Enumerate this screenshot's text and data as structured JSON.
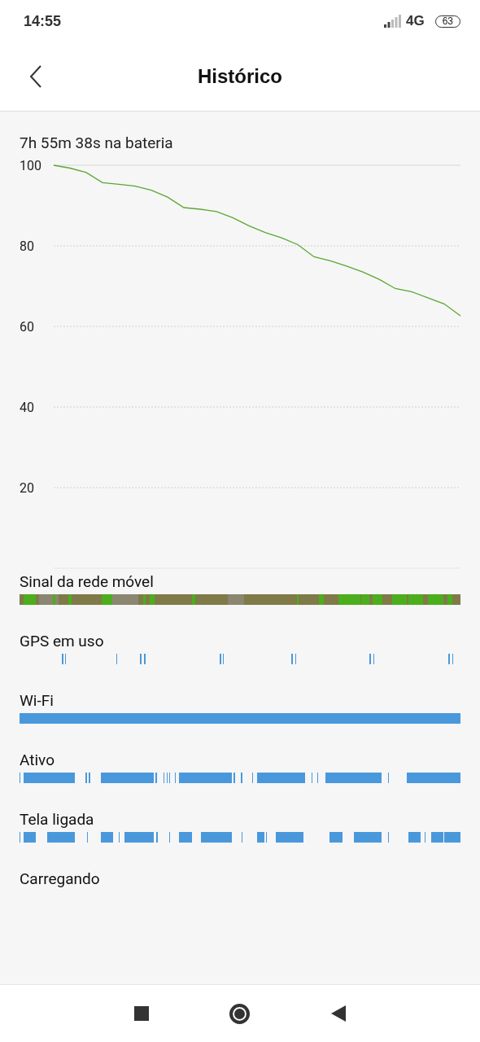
{
  "status_bar": {
    "time": "14:55",
    "network": "4G",
    "battery": "63"
  },
  "header": {
    "title": "Histórico"
  },
  "summary": "7h 55m 38s na bateria",
  "chart_data": {
    "type": "line",
    "ylim": [
      0,
      100
    ],
    "yticks": [
      20,
      40,
      60,
      80,
      100
    ],
    "grid": true,
    "categories": [
      null,
      null,
      null,
      null,
      null,
      null,
      null,
      null,
      null,
      null,
      null,
      null,
      null,
      null,
      null,
      null,
      null,
      null,
      null,
      null,
      null,
      null,
      null,
      null,
      null,
      null
    ],
    "series": [
      {
        "color": "#5aa832",
        "values": [
          100,
          99.3,
          98.2,
          95.7,
          95.3,
          94.8,
          93.8,
          92.1,
          89.5,
          89.1,
          88.5,
          87,
          85,
          83.3,
          82,
          80.3,
          77.3,
          76.3,
          75,
          73.5,
          71.7,
          69.4,
          68.6,
          67.1,
          65.6,
          62.6
        ]
      }
    ]
  },
  "timelines": [
    {
      "label": "Sinal da rede móvel",
      "kind": "signal"
    },
    {
      "label": "GPS em uso",
      "kind": "gps"
    },
    {
      "label": "Wi-Fi",
      "kind": "solid"
    },
    {
      "label": "Ativo",
      "kind": "active"
    },
    {
      "label": "Tela ligada",
      "kind": "screen"
    },
    {
      "label": "Carregando",
      "kind": "none"
    }
  ]
}
